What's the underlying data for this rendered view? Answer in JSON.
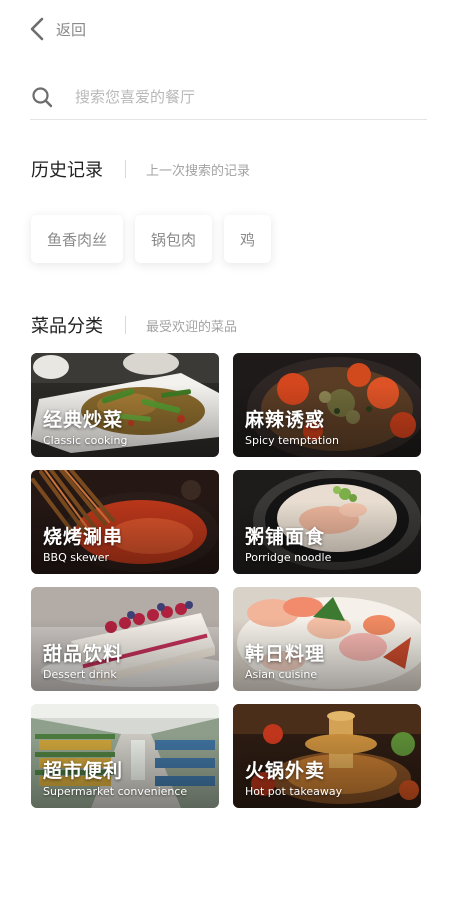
{
  "header": {
    "back_label": "返回"
  },
  "search": {
    "placeholder": "搜索您喜爱的餐厅"
  },
  "history": {
    "title": "历史记录",
    "subtitle": "上一次搜索的记录",
    "items": [
      "鱼香肉丝",
      "锅包肉",
      "鸡"
    ]
  },
  "categories": {
    "title": "菜品分类",
    "subtitle": "最受欢迎的菜品",
    "items": [
      {
        "title": "经典炒菜",
        "subtitle": "Classic cooking"
      },
      {
        "title": "麻辣诱惑",
        "subtitle": "Spicy temptation"
      },
      {
        "title": "烧烤涮串",
        "subtitle": "BBQ skewer"
      },
      {
        "title": "粥铺面食",
        "subtitle": "Porridge noodle"
      },
      {
        "title": "甜品饮料",
        "subtitle": "Dessert drink"
      },
      {
        "title": "韩日料理",
        "subtitle": "Asian cuisine"
      },
      {
        "title": "超市便利",
        "subtitle": "Supermarket convenience"
      },
      {
        "title": "火锅外卖",
        "subtitle": "Hot pot takeaway"
      }
    ]
  },
  "icons": {
    "back": "chevron-left-icon",
    "search": "search-icon"
  },
  "colors": {
    "text_primary": "#222222",
    "text_muted": "#8a8a8a",
    "divider": "#e4e4e4"
  }
}
